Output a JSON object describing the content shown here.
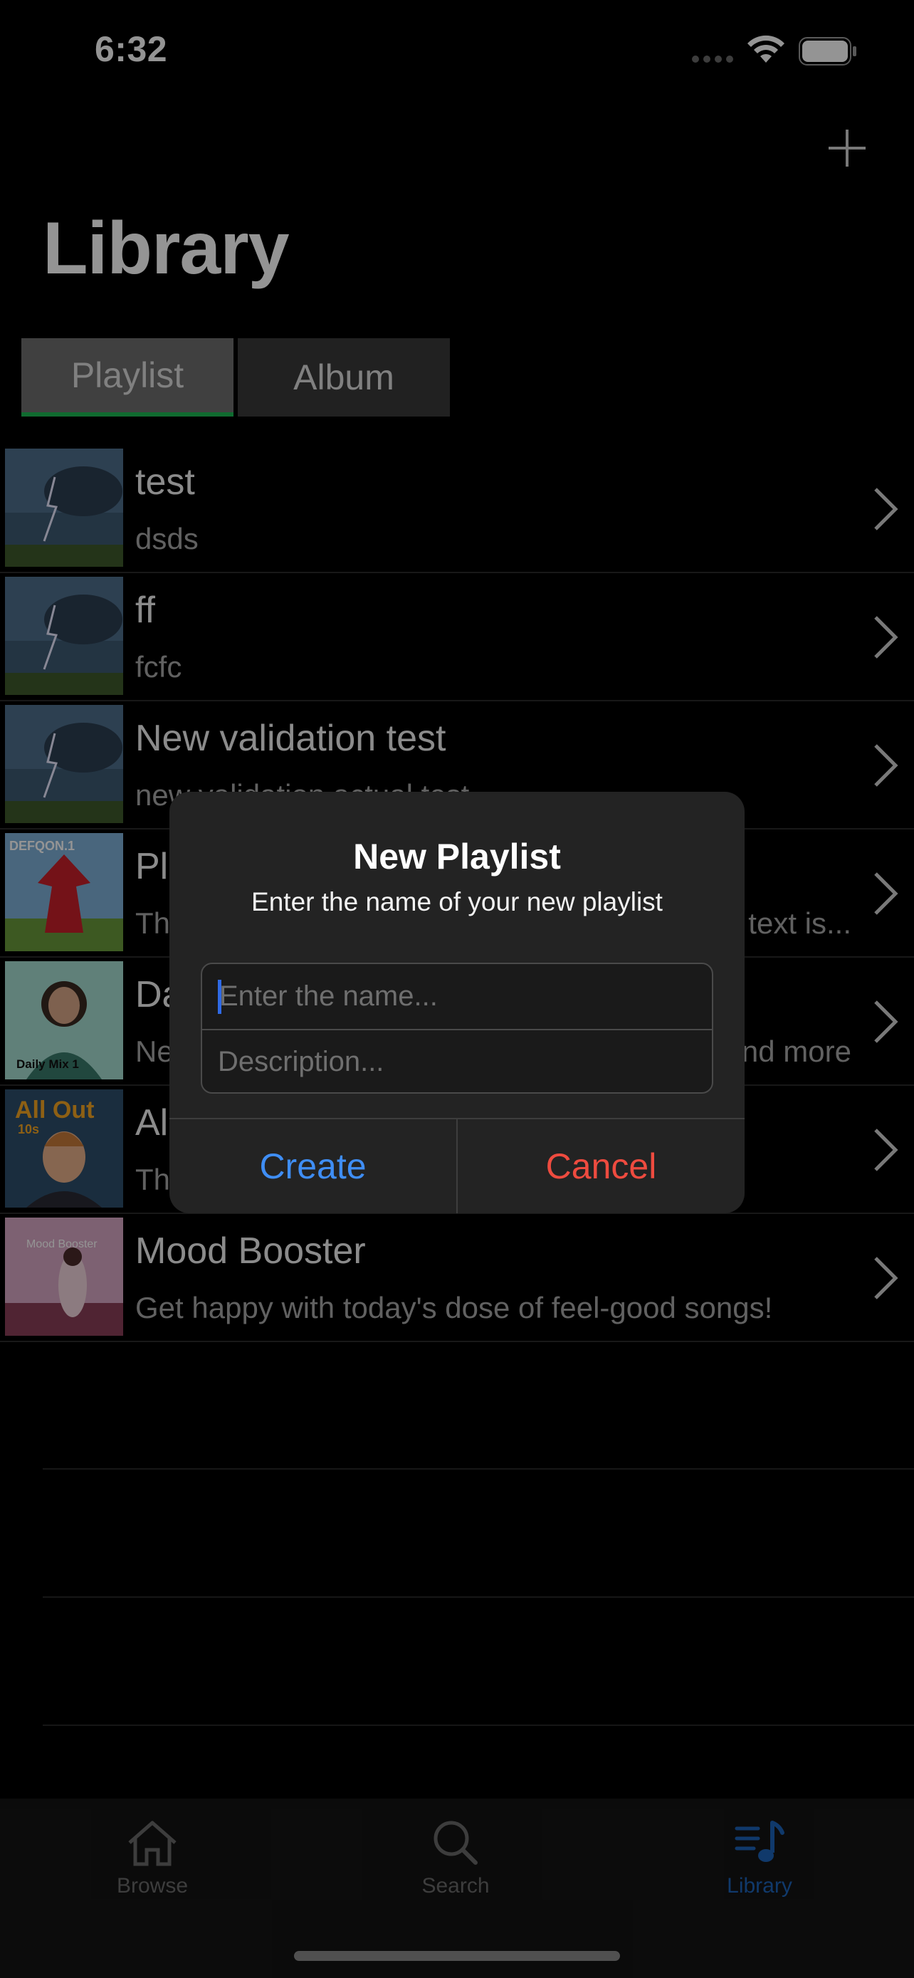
{
  "status_bar": {
    "time": "6:32"
  },
  "header": {
    "title": "Library",
    "add_icon": "plus-icon"
  },
  "segments": [
    {
      "label": "Playlist",
      "selected": true
    },
    {
      "label": "Album",
      "selected": false
    }
  ],
  "accent_color": "#1DB954",
  "playlists": [
    {
      "title": "test",
      "subtitle": "dsds",
      "art": "storm"
    },
    {
      "title": "ff",
      "subtitle": "fcfc",
      "art": "storm"
    },
    {
      "title": "New validation test",
      "subtitle": "new validation actual test",
      "art": "storm"
    },
    {
      "title": "Pl",
      "subtitle": "Th",
      "subtitle_end": "text is...",
      "art": "defqon"
    },
    {
      "title": "Da",
      "subtitle": "Ne",
      "subtitle_end": "nd more",
      "art": "dailymix"
    },
    {
      "title": "Al",
      "subtitle": "Th",
      "art": "allout"
    },
    {
      "title": "Mood Booster",
      "subtitle": "Get happy with today's dose of feel-good songs!",
      "art": "mood"
    }
  ],
  "art_labels": {
    "defqon": "DEFQON.1",
    "dailymix": "Daily Mix 1",
    "allout": "All Out",
    "allout_sub": "10s",
    "mood": "Mood Booster"
  },
  "alert": {
    "title": "New Playlist",
    "message": "Enter the name of your new playlist",
    "name_placeholder": "Enter the name...",
    "description_placeholder": "Description...",
    "create_label": "Create",
    "cancel_label": "Cancel",
    "create_color": "#3f8ef5",
    "cancel_color": "#ee4b3f"
  },
  "tab_bar": {
    "tabs": [
      {
        "label": "Browse",
        "icon": "house-icon",
        "active": false
      },
      {
        "label": "Search",
        "icon": "magnifier-icon",
        "active": false
      },
      {
        "label": "Library",
        "icon": "music-library-icon",
        "active": true
      }
    ],
    "active_color": "#1d63b8"
  }
}
